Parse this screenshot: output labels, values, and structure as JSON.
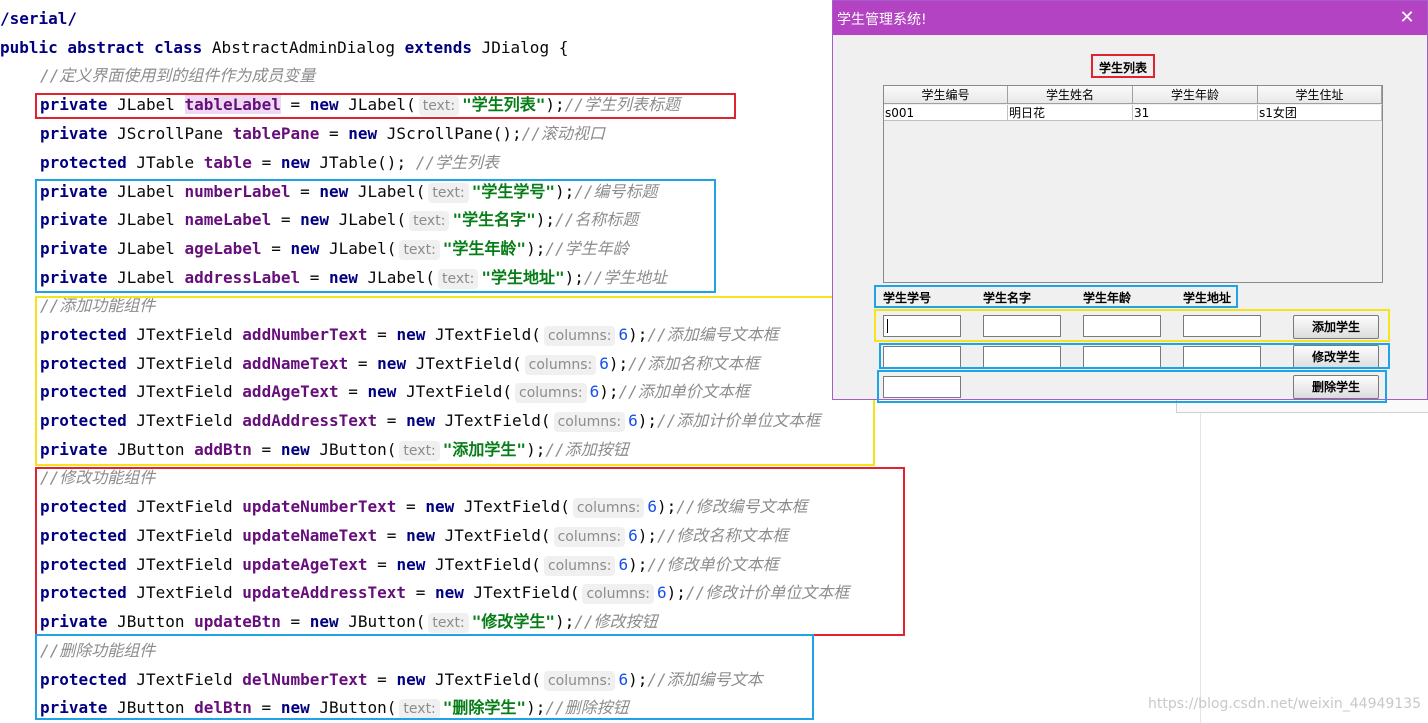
{
  "code": {
    "lines": [
      "/serial/",
      "public abstract class AbstractAdminDialog extends JDialog {",
      "//定义界面使用到的组件作为成员变量",
      "private JLabel tableLabel = new JLabel( text: \"学生列表\");//学生列表标题",
      "private JScrollPane tablePane = new JScrollPane();//滚动视口",
      "protected JTable table = new JTable(); //学生列表",
      "private JLabel numberLabel = new JLabel( text: \"学生学号\");//编号标题",
      "private JLabel nameLabel = new JLabel( text: \"学生名字\");//名称标题",
      "private JLabel ageLabel = new JLabel( text: \"学生年龄\");//学生年龄",
      "private JLabel addressLabel = new JLabel( text: \"学生地址\");//学生地址",
      "//添加功能组件",
      "protected JTextField addNumberText = new JTextField( columns: 6);//添加编号文本框",
      "protected JTextField addNameText = new JTextField( columns: 6);//添加名称文本框",
      "protected JTextField addAgeText = new JTextField( columns: 6);//添加单价文本框",
      "protected JTextField addAddressText = new JTextField( columns: 6);//添加计价单位文本框",
      "private JButton addBtn = new JButton( text: \"添加学生\");//添加按钮",
      "//修改功能组件",
      "protected JTextField updateNumberText = new JTextField( columns: 6);//修改编号文本框",
      "protected JTextField updateNameText = new JTextField( columns: 6);//修改名称文本框",
      "protected JTextField updateAgeText = new JTextField( columns: 6);//修改单价文本框",
      "protected JTextField updateAddressText = new JTextField( columns: 6);//修改计价单位文本框",
      "private JButton updateBtn = new JButton( text: \"修改学生\");//修改按钮",
      "//删除功能组件",
      "protected JTextField delNumberText = new JTextField( columns: 6);//添加编号文本",
      "private JButton delBtn = new JButton( text: \"删除学生\");//删除按钮"
    ]
  },
  "dialog": {
    "title": "学生管理系统!",
    "close_glyph": "✕",
    "list_title": "学生列表",
    "table": {
      "columns": [
        "学生编号",
        "学生姓名",
        "学生年龄",
        "学生住址"
      ],
      "rows": [
        [
          "s001",
          "明日花",
          "31",
          "s1女团"
        ]
      ]
    },
    "labels": [
      "学生学号",
      "学生名字",
      "学生年龄",
      "学生地址"
    ],
    "add_button": "添加学生",
    "update_button": "修改学生",
    "delete_button": "删除学生"
  },
  "watermark": "https://blog.csdn.net/weixin_44949135",
  "colors": {
    "titlebar": "#b443c4",
    "annotation_red": "#e0242f",
    "annotation_blue": "#1ea3e6",
    "annotation_yellow": "#f5e31b"
  }
}
